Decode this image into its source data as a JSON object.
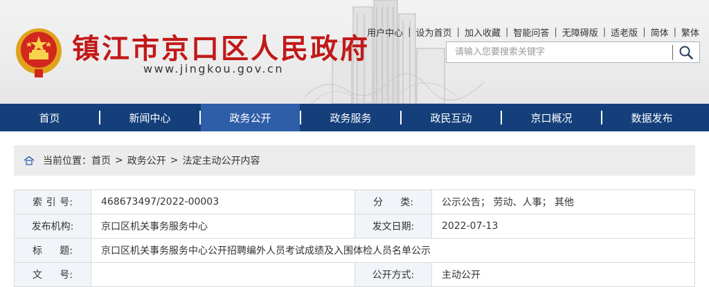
{
  "site": {
    "title": "镇江市京口区人民政府",
    "url": "www.jingkou.gov.cn",
    "emblem_icon": "national-emblem-icon"
  },
  "toplinks": [
    "用户中心",
    "设为首页",
    "加入收藏",
    "智能问答",
    "无障碍版",
    "适老版",
    "简体",
    "繁体"
  ],
  "search": {
    "placeholder": "请输入您要搜索关键字",
    "icon": "search-icon"
  },
  "nav": {
    "items": [
      "首页",
      "新闻中心",
      "政务公开",
      "政务服务",
      "政民互动",
      "京口概况",
      "数据发布"
    ],
    "active": "政务公开"
  },
  "breadcrumb": {
    "prefix": "当前位置：",
    "items": [
      "首页",
      "政务公开",
      "法定主动公开内容"
    ],
    "separator": ">"
  },
  "info": {
    "index_label": [
      "索",
      "引",
      "号:"
    ],
    "index_value": "468673497/2022-00003",
    "category_label": [
      "分",
      "类:"
    ],
    "category_value": "公示公告；  劳动、人事；  其他",
    "publisher_label": "发布机构:",
    "publisher_value": "京口区机关事务服务中心",
    "date_label": "发文日期:",
    "date_value": "2022-07-13",
    "title_label": [
      "标",
      "题:"
    ],
    "title_value": "京口区机关事务服务中心公开招聘编外人员考试成绩及入围体检人员名单公示",
    "docno_label": [
      "文",
      "号:"
    ],
    "docno_value": "",
    "mode_label": "公开方式:",
    "mode_value": "主动公开"
  },
  "colors": {
    "title_red": "#c21818",
    "nav_bg": "#143f7a",
    "nav_active": "#2f5ea8",
    "label_bg": "#f1f4f8"
  }
}
